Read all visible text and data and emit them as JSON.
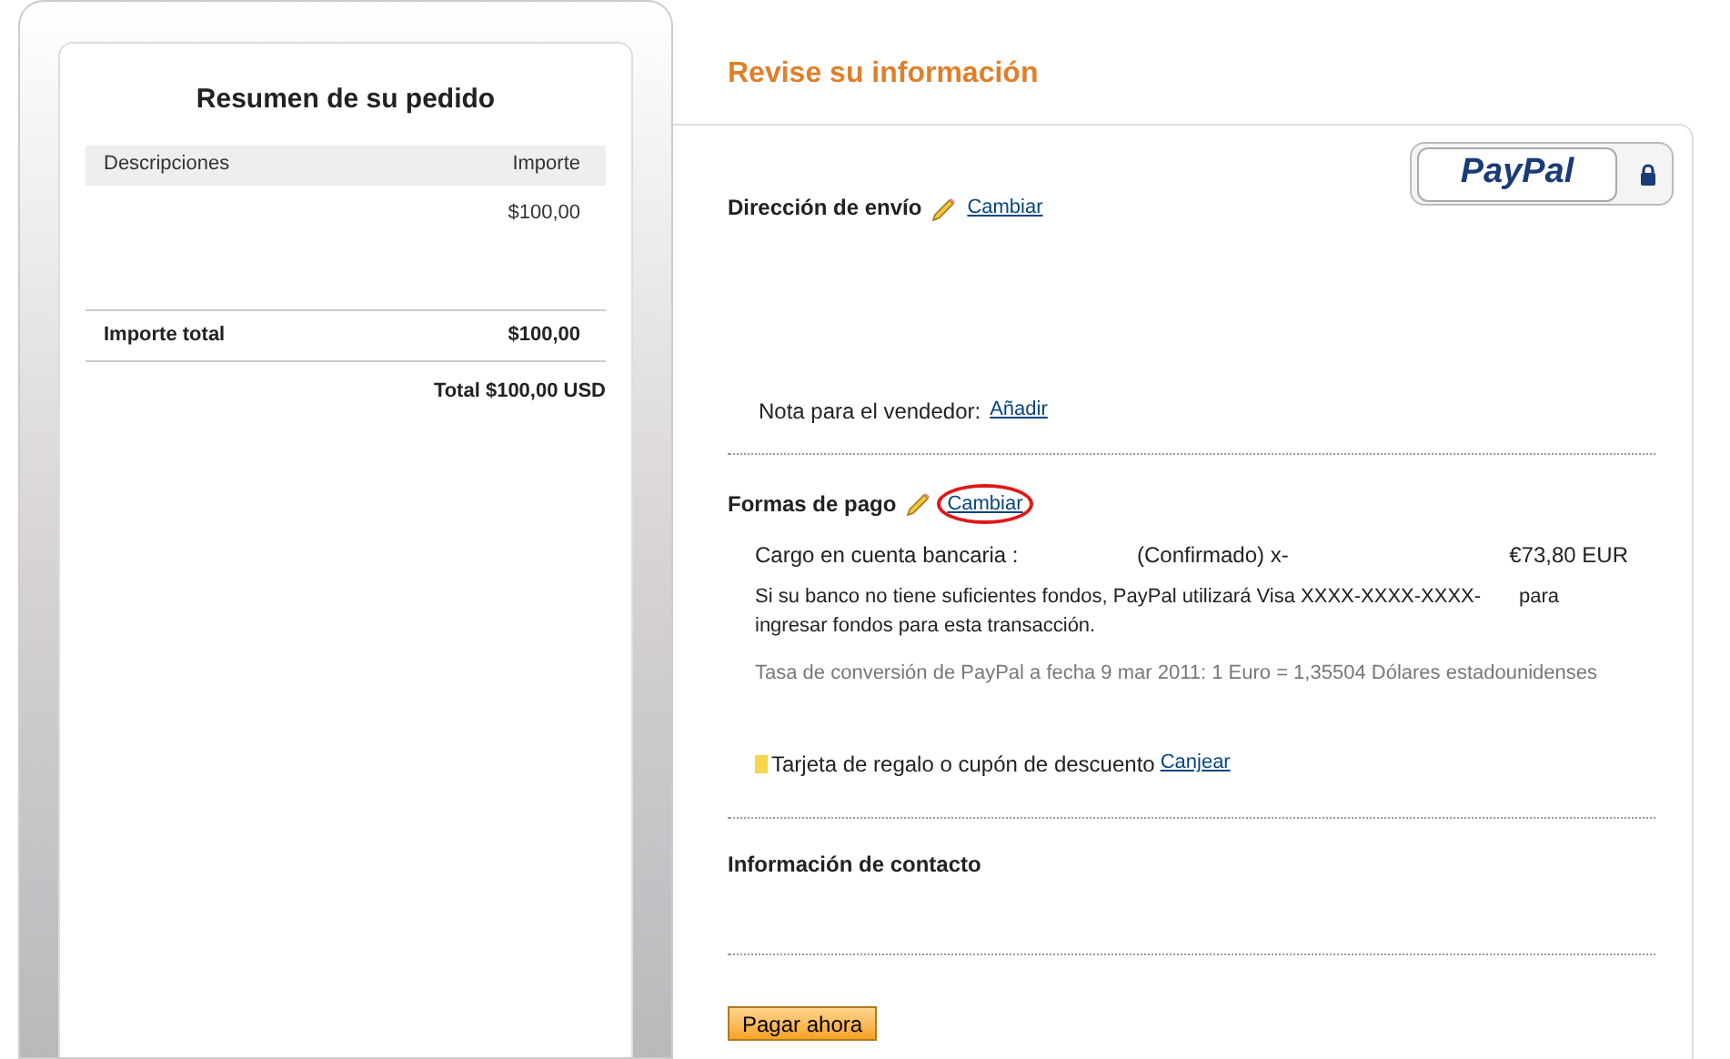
{
  "order_summary": {
    "title": "Resumen de su pedido",
    "columns": [
      "Descripciones",
      "Importe"
    ],
    "rows": [
      {
        "description": "",
        "amount": "$100,00"
      }
    ],
    "total_label": "Importe total",
    "total_amount": "$100,00",
    "grand_total": "Total $100,00 USD"
  },
  "review": {
    "title": "Revise su información",
    "shipping": {
      "heading": "Dirección de envío",
      "change_link": {
        "label": "Cambiar",
        "circled": false
      },
      "note_label": "Nota para el vendedor:",
      "note_link": "Añadir"
    },
    "payment": {
      "heading": "Formas de pago",
      "change_link": {
        "label": "Cambiar",
        "circled": true
      },
      "method": "Cargo en cuenta bancaria :",
      "status": "(Confirmado) x-",
      "amount": "€73,80 EUR",
      "backup_text_1": "Si su banco no tiene suficientes fondos, PayPal utilizará Visa XXXX-XXXX-XXXX-",
      "backup_text_2": "para",
      "backup_text_3": "ingresar fondos para esta transacción.",
      "conversion": "Tasa de conversión de PayPal a fecha 9 mar 2011: 1 Euro = 1,35504 Dólares estadounidenses",
      "gift_label": "Tarjeta de regalo o cupón de descuento",
      "gift_link": "Canjear"
    },
    "contact": {
      "heading": "Información de contacto"
    },
    "pay_button": "Pagar ahora"
  },
  "logo": {
    "text": "PayPal"
  }
}
